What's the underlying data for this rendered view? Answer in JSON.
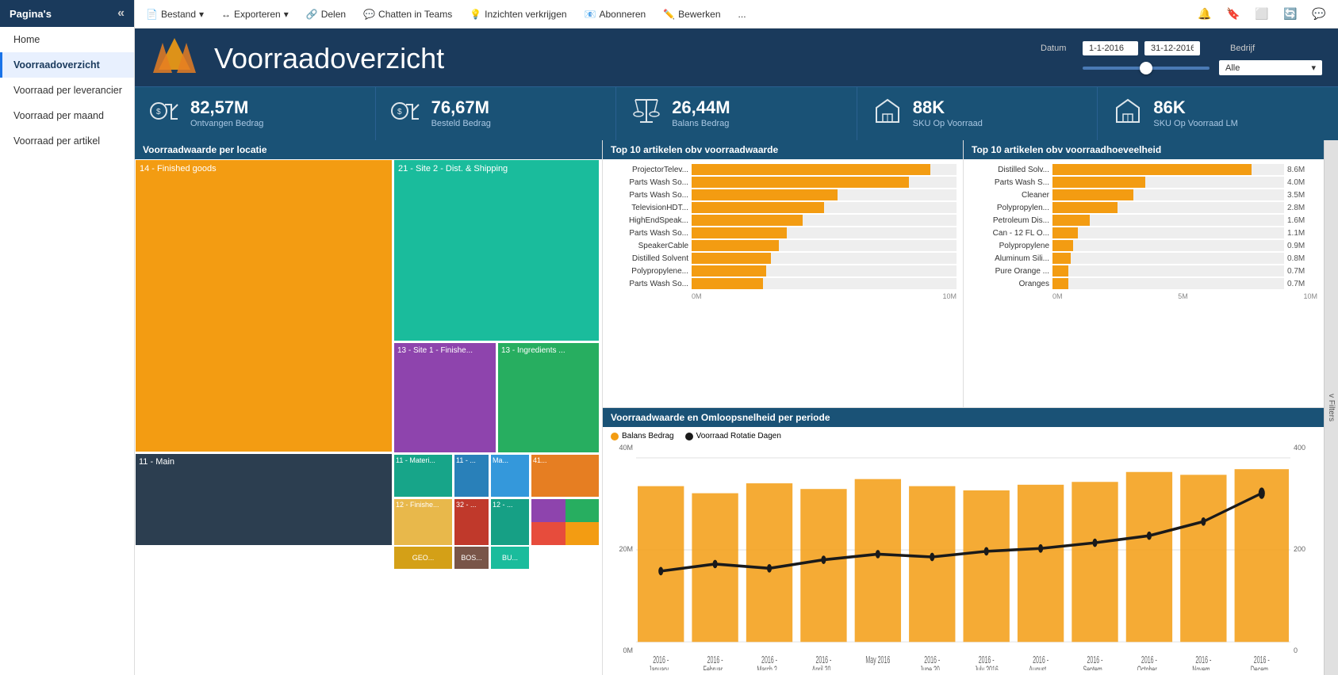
{
  "sidebar": {
    "header": "Pagina's",
    "collapse_icon": "«",
    "items": [
      {
        "label": "Home",
        "active": false
      },
      {
        "label": "Voorraadoverzicht",
        "active": true
      },
      {
        "label": "Voorraad per leverancier",
        "active": false
      },
      {
        "label": "Voorraad per maand",
        "active": false
      },
      {
        "label": "Voorraad per artikel",
        "active": false
      }
    ]
  },
  "toolbar": {
    "items": [
      {
        "label": "Bestand",
        "icon": "📄",
        "has_arrow": true
      },
      {
        "label": "Exporteren",
        "icon": "↔",
        "has_arrow": true
      },
      {
        "label": "Delen",
        "icon": "🔗",
        "has_arrow": false
      },
      {
        "label": "Chatten in Teams",
        "icon": "💬",
        "has_arrow": false
      },
      {
        "label": "Inzichten verkrijgen",
        "icon": "💡",
        "has_arrow": false
      },
      {
        "label": "Abonneren",
        "icon": "📧",
        "has_arrow": false
      },
      {
        "label": "Bewerken",
        "icon": "✏️",
        "has_arrow": false
      },
      {
        "label": "...",
        "icon": "",
        "has_arrow": false
      }
    ]
  },
  "dashboard": {
    "title": "Voorraadoverzicht",
    "filters": {
      "datum_label": "Datum",
      "date_from": "1-1-2016",
      "date_to": "31-12-2016",
      "bedrijf_label": "Bedrijf",
      "bedrijf_value": "Alle"
    },
    "kpis": [
      {
        "value": "82,57M",
        "label": "Ontvangen Bedrag",
        "icon": "💰"
      },
      {
        "value": "76,67M",
        "label": "Besteld Bedrag",
        "icon": "🛒"
      },
      {
        "value": "26,44M",
        "label": "Balans Bedrag",
        "icon": "⚖"
      },
      {
        "value": "88K",
        "label": "SKU Op Voorraad",
        "icon": "🏠"
      },
      {
        "value": "86K",
        "label": "SKU Op Voorraad LM",
        "icon": "🏠"
      }
    ],
    "charts": {
      "treemap_title": "Voorraadwaarde per locatie",
      "top10_value_title": "Top 10 artikelen obv voorraadwaarde",
      "top10_qty_title": "Top 10 artikelen obv voorraadhoeveelheid",
      "bottom_title": "Voorraadwaarde en Omloopsnelheid per periode",
      "top10_value_items": [
        {
          "label": "ProjectorTelev...",
          "pct": 90,
          "value": ""
        },
        {
          "label": "Parts Wash So...",
          "pct": 82,
          "value": ""
        },
        {
          "label": "Parts Wash So...",
          "pct": 55,
          "value": ""
        },
        {
          "label": "TelevisionHDT...",
          "pct": 50,
          "value": ""
        },
        {
          "label": "HighEndSpeak...",
          "pct": 42,
          "value": ""
        },
        {
          "label": "Parts Wash So...",
          "pct": 36,
          "value": ""
        },
        {
          "label": "SpeakerCable",
          "pct": 33,
          "value": ""
        },
        {
          "label": "Distilled Solvent",
          "pct": 30,
          "value": ""
        },
        {
          "label": "Polypropylene...",
          "pct": 28,
          "value": ""
        },
        {
          "label": "Parts Wash So...",
          "pct": 27,
          "value": ""
        }
      ],
      "top10_value_axis": [
        "0M",
        "10M"
      ],
      "top10_qty_items": [
        {
          "label": "Distilled Solv...",
          "pct": 86,
          "value": "8.6M"
        },
        {
          "label": "Parts Wash S...",
          "pct": 40,
          "value": "4.0M"
        },
        {
          "label": "Cleaner",
          "pct": 35,
          "value": "3.5M"
        },
        {
          "label": "Polypropylen...",
          "pct": 28,
          "value": "2.8M"
        },
        {
          "label": "Petroleum Dis...",
          "pct": 16,
          "value": "1.6M"
        },
        {
          "label": "Can - 12 FL O...",
          "pct": 11,
          "value": "1.1M"
        },
        {
          "label": "Polypropylene",
          "pct": 9,
          "value": "0.9M"
        },
        {
          "label": "Aluminum Sili...",
          "pct": 8,
          "value": "0.8M"
        },
        {
          "label": "Pure Orange ...",
          "pct": 7,
          "value": "0.7M"
        },
        {
          "label": "Oranges",
          "pct": 7,
          "value": "0.7M"
        }
      ],
      "top10_qty_axis": [
        "0M",
        "5M",
        "10M"
      ],
      "bottom_legend": [
        {
          "label": "Balans Bedrag",
          "color": "#f39c12"
        },
        {
          "label": "Voorraad Rotatie Dagen",
          "color": "#1a1a1a"
        }
      ],
      "bottom_y_left": [
        "40M",
        "20M",
        "0M"
      ],
      "bottom_y_right": [
        "400",
        "200",
        "0"
      ],
      "bottom_months": [
        "2016 -\nJanuary...",
        "2016 -\nFebruar...",
        "2016 -\nMarch 2...",
        "2016 -\nApril 20...",
        "May 2016",
        "2016 -\nJune 20...",
        "2016 -\nJuly 2016",
        "2016 -\nAugust ...",
        "2016 -\nSeptem...",
        "2016 -\nOctober...",
        "2016 -\nNovem...",
        "2016 -\nDecem..."
      ]
    }
  },
  "filters_panel": {
    "label": "v Filters"
  },
  "topbar_right_icons": [
    "🔔",
    "🔖",
    "⬜",
    "🔄",
    "💬"
  ]
}
